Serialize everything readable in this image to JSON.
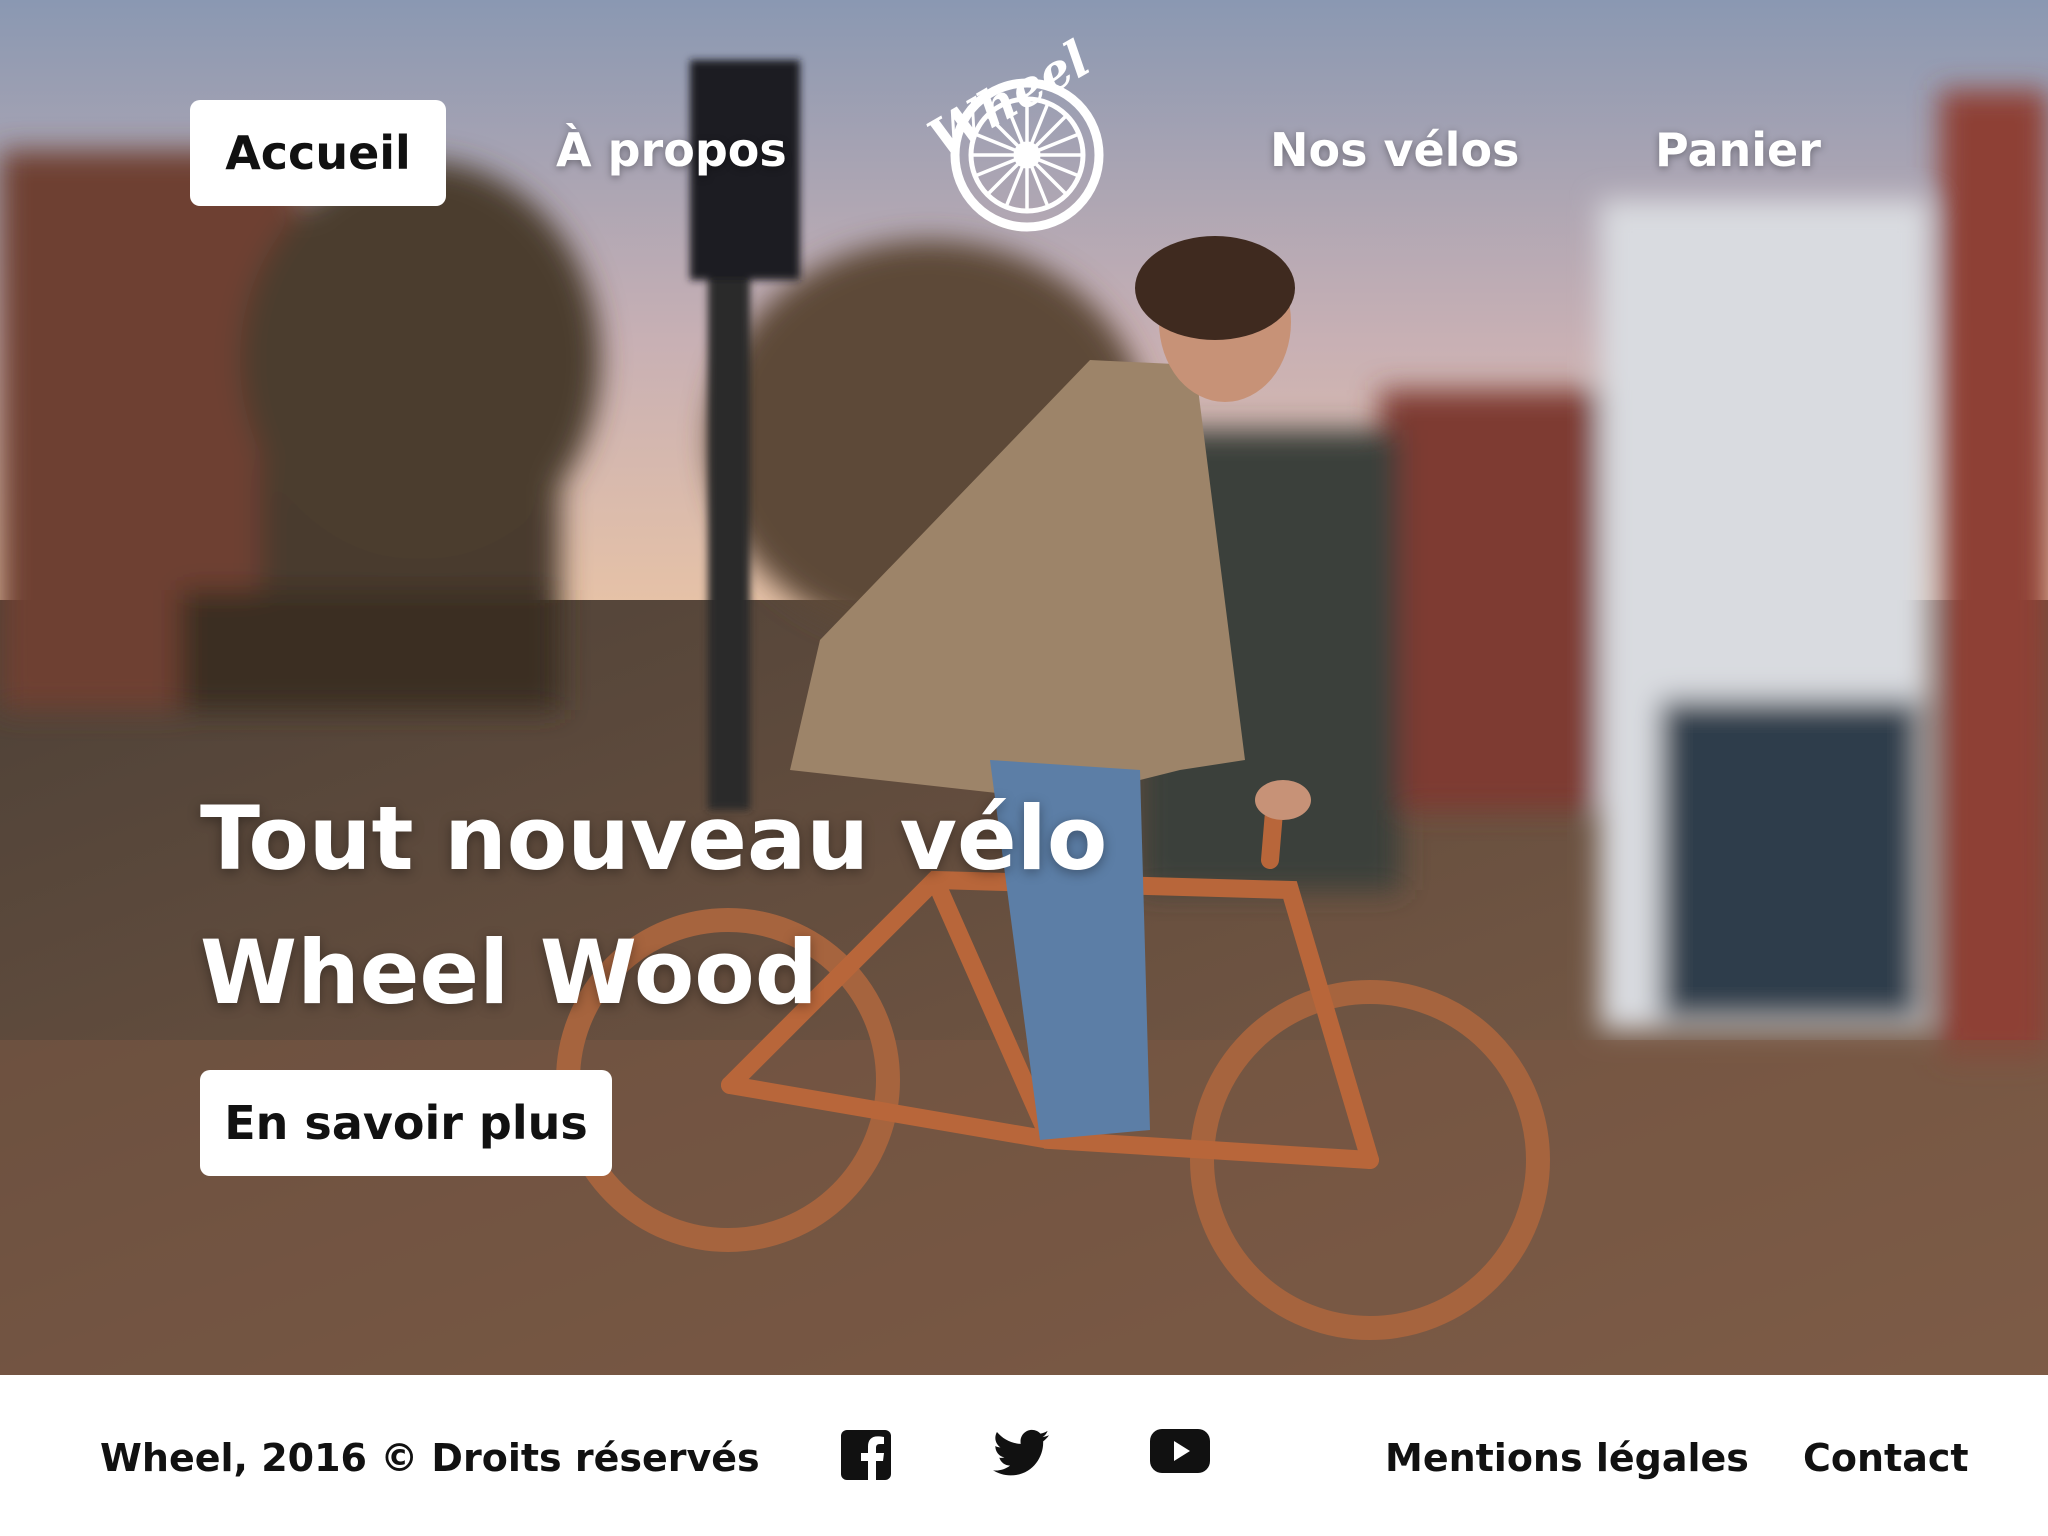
{
  "nav": {
    "home": "Accueil",
    "about": "À propos",
    "bikes": "Nos vélos",
    "cart": "Panier",
    "logo_text": "Wheel"
  },
  "hero": {
    "title_line1": "Tout nouveau vélo",
    "title_line2": "Wheel Wood",
    "cta": "En savoir plus"
  },
  "footer": {
    "copyright": "Wheel, 2016 © Droits réservés",
    "legal": "Mentions légales",
    "contact": "Contact",
    "social_icons": [
      "facebook-icon",
      "twitter-icon",
      "youtube-icon"
    ]
  },
  "colors": {
    "text_dark": "#111111",
    "button_bg": "#ffffff",
    "wood_frame": "#b8663a"
  }
}
